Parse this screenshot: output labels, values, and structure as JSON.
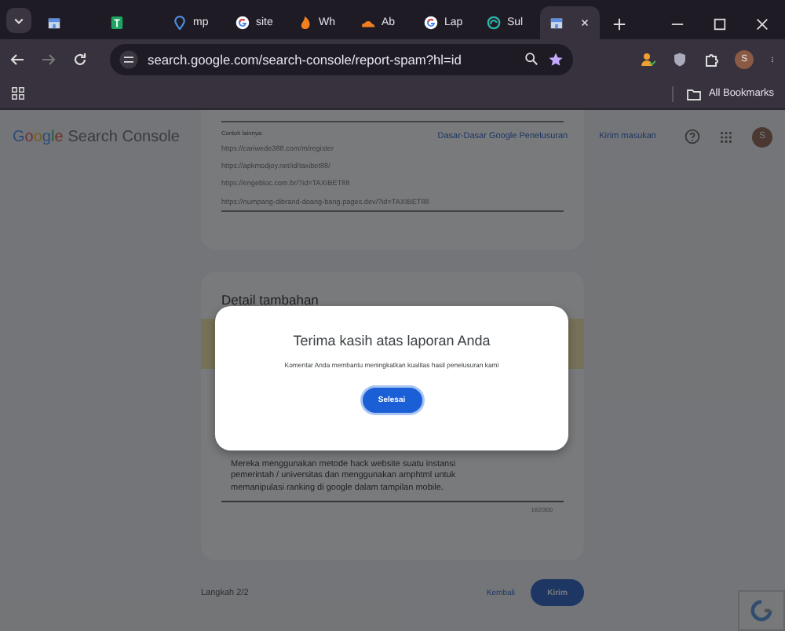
{
  "browser": {
    "tabs": [
      {
        "selected": false
      },
      {
        "selected": false
      },
      {
        "title": "mp",
        "selected": false
      },
      {
        "title": "site",
        "selected": false
      },
      {
        "title": "Wh",
        "selected": false
      },
      {
        "title": "Ab",
        "selected": false
      },
      {
        "title": "Lap",
        "selected": false
      },
      {
        "title": "Sul",
        "selected": false
      },
      {
        "selected": true
      }
    ],
    "address": "search.google.com/search-console/report-spam?hl=id",
    "bookmarks_label": "All Bookmarks",
    "profile_initial": "S"
  },
  "header": {
    "brand": "Google",
    "product": "Search Console",
    "links": [
      "Dasar-Dasar Google Penelusuran",
      "Kirim masukan"
    ],
    "avatar_initial": "S"
  },
  "examples_card": {
    "label": "Contoh lainnya:",
    "urls": [
      "https://cariwede388.com/m/register",
      "https://apkmodjoy.net/id/taxibet88/",
      "https://engebloc.com.br/?id=TAXIBET88",
      "https://numpang-dibrand-doang-bang.pages.dev/?id=TAXIBET88"
    ]
  },
  "details_card": {
    "title": "Detail tambahan",
    "comment": "Mereka menggunakan metode hack website suatu instansi pemerintah / universitas dan menggunakan amphtml untuk memanipulasi ranking di google dalam tampilan mobile.",
    "counter": "162/300"
  },
  "footer": {
    "step": "Langkah 2/2",
    "back": "Kembali",
    "submit": "Kirim"
  },
  "dialog": {
    "title": "Terima kasih atas laporan Anda",
    "message": "Komentar Anda membantu meningkatkan kualitas hasil penelusuran kami",
    "button": "Selesai"
  }
}
